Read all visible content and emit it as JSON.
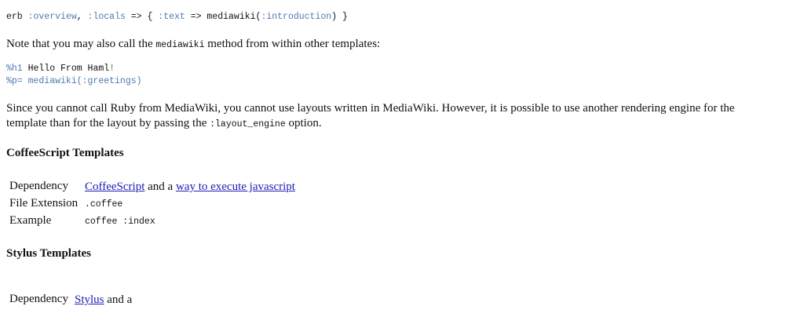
{
  "code1": {
    "erb": "erb",
    "sym_overview": ":overview",
    "comma1": ",",
    "sym_locals": ":locals",
    "arrow1": "=> {",
    "sym_text": ":text",
    "arrow2": "=> mediawiki(",
    "sym_intro": ":introduction",
    "close": ") }"
  },
  "para1": {
    "before": "Note that you may also call the",
    "code": "mediawiki",
    "after": "method from within other templates:"
  },
  "code2": {
    "line1_prefix": "%h1",
    "line1_text": "Hello From Haml",
    "line1_bang": "!",
    "line2": "%p= mediawiki(:greetings)"
  },
  "para2": {
    "line1": "Since you cannot call Ruby from MediaWiki, you cannot use layouts written in MediaWiki. However, it is possible to use another rendering engine for the",
    "line2_before": "template than for the layout by passing the",
    "line2_code": ":layout_engine",
    "line2_after": "option."
  },
  "coffee": {
    "heading": "CoffeeScript Templates",
    "dependency_label": "Dependency",
    "dependency_link1": "CoffeeScript",
    "dependency_and": "and a",
    "dependency_link2": "way to execute javascript",
    "extension_label": "File Extension",
    "extension_value": ".coffee",
    "example_label": "Example",
    "example_value": "coffee :index"
  },
  "stylus": {
    "heading": "Stylus Templates",
    "dependency_label": "Dependency",
    "dependency_link1": "Stylus",
    "dependency_and": "and a"
  }
}
